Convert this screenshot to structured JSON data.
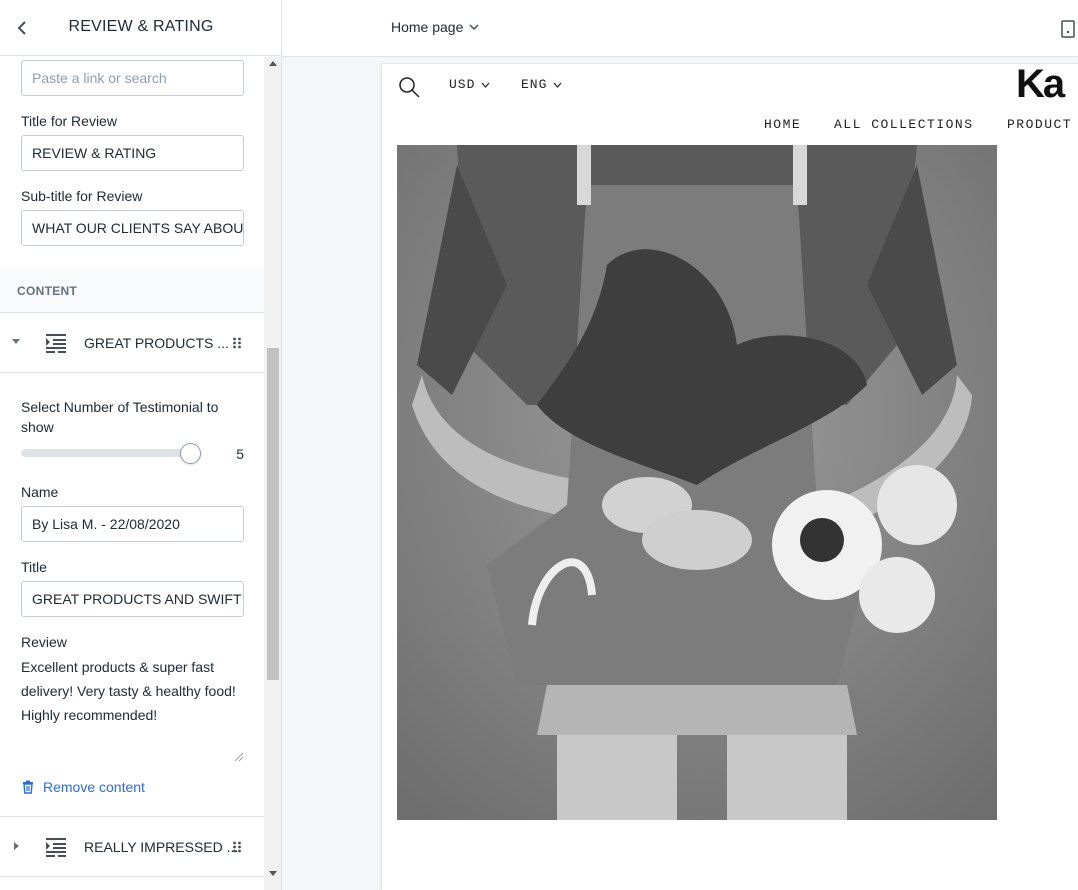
{
  "sidebar": {
    "title": "REVIEW & RATING",
    "link_input": {
      "placeholder": "Paste a link or search"
    },
    "title_field": {
      "label": "Title for Review",
      "value": "REVIEW & RATING"
    },
    "subtitle_field": {
      "label": "Sub-title for Review",
      "value": "WHAT OUR CLIENTS SAY ABOUT"
    },
    "content_heading": "CONTENT",
    "blocks": [
      {
        "label": "GREAT PRODUCTS ...",
        "expanded": true
      },
      {
        "label": "REALLY IMPRESSED ...",
        "expanded": false
      }
    ],
    "testimonial_count": {
      "label": "Select Number of Testimonial to show",
      "value": "5"
    },
    "name_field": {
      "label": "Name",
      "value": "By Lisa M. - 22/08/2020"
    },
    "block_title_field": {
      "label": "Title",
      "value": "GREAT PRODUCTS AND SWIFT D"
    },
    "review_field": {
      "label": "Review",
      "value": "Excellent products & super fast delivery! Very tasty & healthy food! Highly recommended!"
    },
    "remove_label": "Remove content"
  },
  "topbar": {
    "page_select": "Home page"
  },
  "store": {
    "currency": "USD",
    "language": "ENG",
    "logo": "Ka",
    "nav": [
      "HOME",
      "ALL COLLECTIONS",
      "PRODUCT"
    ]
  },
  "colors": {
    "accent_link": "#2c6ecb",
    "border": "#dfe3e8",
    "preview_bg": "#f4f6f8"
  }
}
